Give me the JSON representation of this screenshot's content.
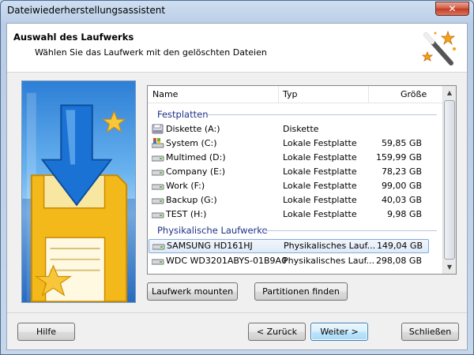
{
  "window": {
    "title": "Dateiwiederherstellungsassistent",
    "close_glyph": "✕"
  },
  "header": {
    "title": "Auswahl des Laufwerks",
    "subtitle": "Wählen Sie das Laufwerk mit den gelöschten Dateien",
    "wand_icon": "magic-wand-icon"
  },
  "list": {
    "columns": {
      "name": "Name",
      "type": "Typ",
      "size": "Größe"
    },
    "groups": [
      {
        "label": "Festplatten",
        "items": [
          {
            "name": "Diskette (A:)",
            "type": "Diskette",
            "size": "",
            "icon": "floppy-drive-icon"
          },
          {
            "name": "System (C:)",
            "type": "Lokale Festplatte",
            "size": "59,85 GB",
            "icon": "system-drive-icon"
          },
          {
            "name": "Multimed (D:)",
            "type": "Lokale Festplatte",
            "size": "159,99 GB",
            "icon": "hard-drive-icon"
          },
          {
            "name": "Company (E:)",
            "type": "Lokale Festplatte",
            "size": "78,23 GB",
            "icon": "hard-drive-icon"
          },
          {
            "name": "Work (F:)",
            "type": "Lokale Festplatte",
            "size": "99,00 GB",
            "icon": "hard-drive-icon"
          },
          {
            "name": "Backup (G:)",
            "type": "Lokale Festplatte",
            "size": "40,03 GB",
            "icon": "hard-drive-icon"
          },
          {
            "name": "TEST (H:)",
            "type": "Lokale Festplatte",
            "size": "9,98 GB",
            "icon": "hard-drive-icon"
          }
        ]
      },
      {
        "label": "Physikalische Laufwerke",
        "items": [
          {
            "name": "SAMSUNG HD161HJ",
            "type": "Physikalisches Lauf...",
            "size": "149,04 GB",
            "icon": "hard-drive-icon",
            "selected": true
          },
          {
            "name": "WDC WD3201ABYS-01B9A0",
            "type": "Physikalisches Lauf...",
            "size": "298,08 GB",
            "icon": "hard-drive-icon"
          }
        ]
      }
    ]
  },
  "buttons": {
    "mount": "Laufwerk mounten",
    "find_partitions": "Partitionen finden",
    "help": "Hilfe",
    "back": "< Zurück",
    "next": "Weiter >",
    "close": "Schließen"
  },
  "colors": {
    "group_text": "#1e3287",
    "selection_border": "#84acdd",
    "accent_blue": "#2d7fd6"
  }
}
